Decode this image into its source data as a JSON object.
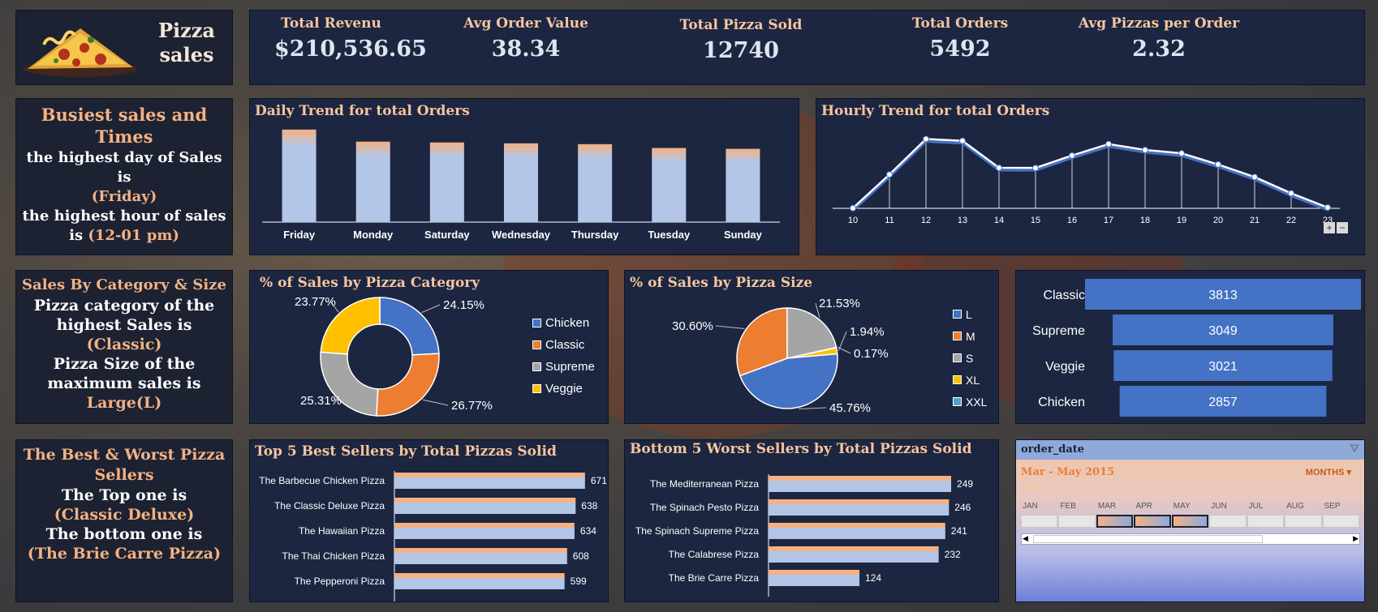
{
  "header": {
    "logo_title": "Pizza sales",
    "logo_line1": "Pizza",
    "logo_line2": "sales"
  },
  "kpis": [
    {
      "label": "Total Revenu",
      "value": "$210,536.65"
    },
    {
      "label": "Avg Order Value",
      "value": "38.34"
    },
    {
      "label": "Total Pizza Sold",
      "value": "12740"
    },
    {
      "label": "Total Orders",
      "value": "5492"
    },
    {
      "label": "Avg Pizzas per Order",
      "value": "2.32"
    }
  ],
  "insight_busiest": {
    "title_line1": "Busiest sales and",
    "title_line2": "Times",
    "line1": "the highest day of Sales",
    "line2": "is",
    "line3": "(Friday)",
    "line4": "the highest hour of sales",
    "line5_a": "is ",
    "line5_b": "(12-01 pm)"
  },
  "insight_category": {
    "title": "Sales By Category & Size",
    "line1": "Pizza category of the",
    "line2": "highest Sales is",
    "line3": "(Classic)",
    "line4": "Pizza Size of the",
    "line5": "maximum sales is",
    "line6": "Large(L)"
  },
  "insight_sellers": {
    "title_line1": "The Best & Worst Pizza",
    "title_line2": "Sellers",
    "line1": "The Top one is",
    "line2": "(Classic Deluxe)",
    "line3": "The bottom one is",
    "line4": "(The Brie Carre Pizza)"
  },
  "colors": {
    "panel": "#1c2641",
    "accent_peach": "#f4b183",
    "bar_blue": "#b4c6e7",
    "chicken": "#4472c4",
    "classic": "#ed7d31",
    "supreme": "#a5a5a5",
    "veggie": "#ffc000"
  },
  "daily_chart": {
    "title": "Daily Trend for total Orders",
    "chart_data": {
      "type": "bar",
      "categories": [
        "Friday",
        "Monday",
        "Saturday",
        "Wednesday",
        "Thursday",
        "Tuesday",
        "Sunday"
      ],
      "values": [
        1029,
        895,
        886,
        876,
        867,
        824,
        815
      ],
      "ylim": [
        0,
        1100
      ]
    }
  },
  "hourly_chart": {
    "title": "Hourly Trend for total Orders",
    "chart_data": {
      "type": "line",
      "x": [
        "10",
        "11",
        "12",
        "13",
        "14",
        "15",
        "16",
        "17",
        "18",
        "19",
        "20",
        "21",
        "22",
        "23"
      ],
      "values": [
        8,
        1231,
        2520,
        2455,
        1472,
        1468,
        1920,
        2336,
        2123,
        2000,
        1595,
        1137,
        547,
        28
      ],
      "ylim": [
        0,
        2800
      ]
    },
    "zoom_in": "+",
    "zoom_out": "−"
  },
  "category_chart": {
    "title": "% of Sales by Pizza Category",
    "chart_data": {
      "type": "pie",
      "donut": true,
      "labels": [
        "Chicken",
        "Classic",
        "Supreme",
        "Veggie"
      ],
      "values": [
        24.15,
        26.77,
        25.31,
        23.77
      ],
      "value_labels": [
        "24.15%",
        "26.77%",
        "25.31%",
        "23.77%"
      ],
      "colors": [
        "#4472c4",
        "#ed7d31",
        "#a5a5a5",
        "#ffc000"
      ]
    }
  },
  "size_chart": {
    "title": "% of Sales by Pizza Size",
    "chart_data": {
      "type": "pie",
      "labels": [
        "L",
        "M",
        "S",
        "XL",
        "XXL"
      ],
      "values": [
        45.76,
        30.6,
        21.53,
        1.94,
        0.17
      ],
      "value_labels": [
        "45.76%",
        "30.60%",
        "21.53%",
        "1.94%",
        "0.17%"
      ],
      "colors": [
        "#4472c4",
        "#ed7d31",
        "#a5a5a5",
        "#ffc000",
        "#5b9bd5"
      ]
    }
  },
  "category_bars": {
    "chart_data": {
      "type": "bar",
      "orientation": "horizontal",
      "categories": [
        "Classic",
        "Supreme",
        "Veggie",
        "Chicken"
      ],
      "values": [
        3813,
        3049,
        3021,
        2857
      ]
    }
  },
  "best_sellers": {
    "title": "Top 5 Best Sellers by Total Pizzas Solid",
    "chart_data": {
      "type": "bar",
      "orientation": "horizontal",
      "categories": [
        "The Barbecue Chicken Pizza",
        "The Classic Deluxe Pizza",
        "The Hawaiian Pizza",
        "The Thai Chicken Pizza",
        "The Pepperoni Pizza"
      ],
      "values": [
        671,
        638,
        634,
        608,
        599
      ],
      "xlim": [
        0,
        700
      ]
    }
  },
  "worst_sellers": {
    "title": "Bottom 5 Worst Sellers by Total Pizzas Solid",
    "chart_data": {
      "type": "bar",
      "orientation": "horizontal",
      "categories": [
        "The Mediterranean Pizza",
        "The Spinach Pesto Pizza",
        "The Spinach Supreme Pizza",
        "The Calabrese Pizza",
        "The Brie Carre Pizza"
      ],
      "values": [
        249,
        246,
        241,
        232,
        124
      ],
      "xlim": [
        0,
        270
      ]
    }
  },
  "slicer": {
    "title": "order_date",
    "range_label": "Mar - May 2015",
    "year": "2015",
    "mode": "MONTHS",
    "months": [
      "JAN",
      "FEB",
      "MAR",
      "APR",
      "MAY",
      "JUN",
      "JUL",
      "AUG",
      "SEP"
    ],
    "selected": [
      "MAR",
      "APR",
      "MAY"
    ],
    "clear_icon": "filter-clear-icon"
  }
}
